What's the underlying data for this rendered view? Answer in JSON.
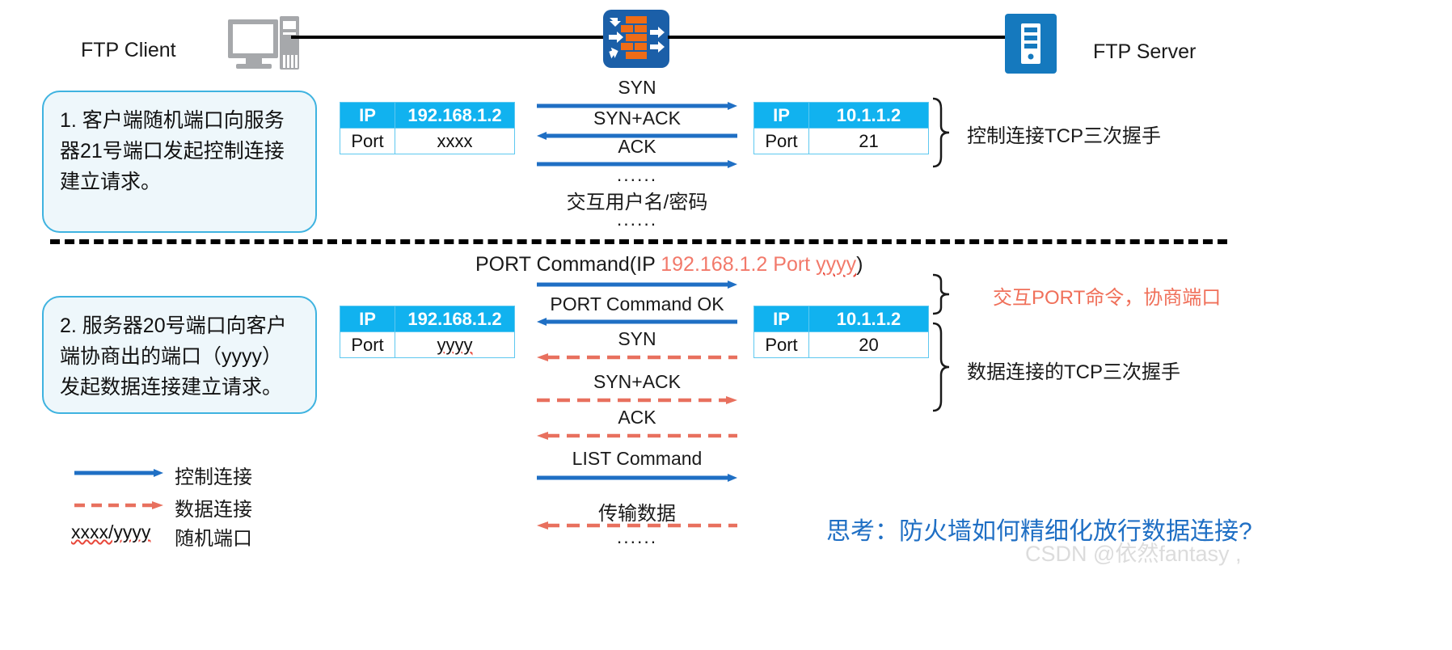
{
  "topology": {
    "client_label": "FTP Client",
    "server_label": "FTP Server",
    "client_icon": "desktop-computer-icon",
    "firewall_icon": "firewall-brick-icon",
    "server_icon": "server-rack-icon"
  },
  "colors": {
    "control_blue": "#1f6fc4",
    "data_red": "#e8705e",
    "table_header": "#11b2ef",
    "callout_border": "#3fb3e0",
    "callout_fill": "#eef7fb",
    "firewall_blue": "#1b5fa8",
    "brick_orange": "#ef6c16",
    "question_blue": "#1f6fc4",
    "watermark_gray": "#dcdcdc"
  },
  "step1": {
    "callout": "1. 客户端随机端口向服务器21号端口发起控制连接建立请求。",
    "client_table": {
      "header_key": "IP",
      "header_value": "192.168.1.2",
      "row_key": "Port",
      "row_value": "xxxx"
    },
    "server_table": {
      "header_key": "IP",
      "header_value": "10.1.1.2",
      "row_key": "Port",
      "row_value": "21"
    },
    "flows": [
      {
        "label": "SYN",
        "dir": "right",
        "style": "solid",
        "color": "#1f6fc4"
      },
      {
        "label": "SYN+ACK",
        "dir": "left",
        "style": "solid",
        "color": "#1f6fc4"
      },
      {
        "label": "ACK",
        "dir": "right",
        "style": "solid",
        "color": "#1f6fc4"
      }
    ],
    "dots_top": "......",
    "auth_label": "交互用户名/密码",
    "dots_bottom": "......",
    "brace_note": "控制连接TCP三次握手"
  },
  "step2": {
    "callout": "2. 服务器20号端口向客户端协商出的端口（yyyy）发起数据连接建立请求。",
    "port_command": {
      "prefix": "PORT Command(IP ",
      "ip": "192.168.1.2",
      "mid": " Port ",
      "port": "yyyy",
      "suffix": ")"
    },
    "client_table": {
      "header_key": "IP",
      "header_value": "192.168.1.2",
      "row_key": "Port",
      "row_value": "yyyy"
    },
    "server_table": {
      "header_key": "IP",
      "header_value": "10.1.1.2",
      "row_key": "Port",
      "row_value": "20"
    },
    "flows": [
      {
        "label": "PORT Command OK",
        "dir": "left",
        "style": "solid",
        "color": "#1f6fc4"
      },
      {
        "label": "SYN",
        "dir": "left",
        "style": "dashed",
        "color": "#e8705e"
      },
      {
        "label": "SYN+ACK",
        "dir": "right",
        "style": "dashed",
        "color": "#e8705e"
      },
      {
        "label": "ACK",
        "dir": "left",
        "style": "dashed",
        "color": "#e8705e"
      },
      {
        "label": "LIST Command",
        "dir": "right",
        "style": "solid",
        "color": "#1f6fc4"
      },
      {
        "label": "传输数据",
        "dir": "left",
        "style": "dashed",
        "color": "#e8705e"
      }
    ],
    "dots_bottom": "......",
    "brace_note_negotiate": "交互PORT命令，协商端口",
    "brace_note_handshake": "数据连接的TCP三次握手"
  },
  "legend": {
    "items": [
      {
        "key": "control-connection",
        "label": "控制连接",
        "style": "solid",
        "color": "#1f6fc4"
      },
      {
        "key": "data-connection",
        "label": "数据连接",
        "style": "dashed",
        "color": "#e8705e"
      },
      {
        "key": "random-port",
        "label": "随机端口",
        "style": "text",
        "text": "xxxx/yyyy"
      }
    ]
  },
  "footer": {
    "question": "思考：防火墙如何精细化放行数据连接?",
    "watermark": "CSDN @依然fantasy ,"
  }
}
